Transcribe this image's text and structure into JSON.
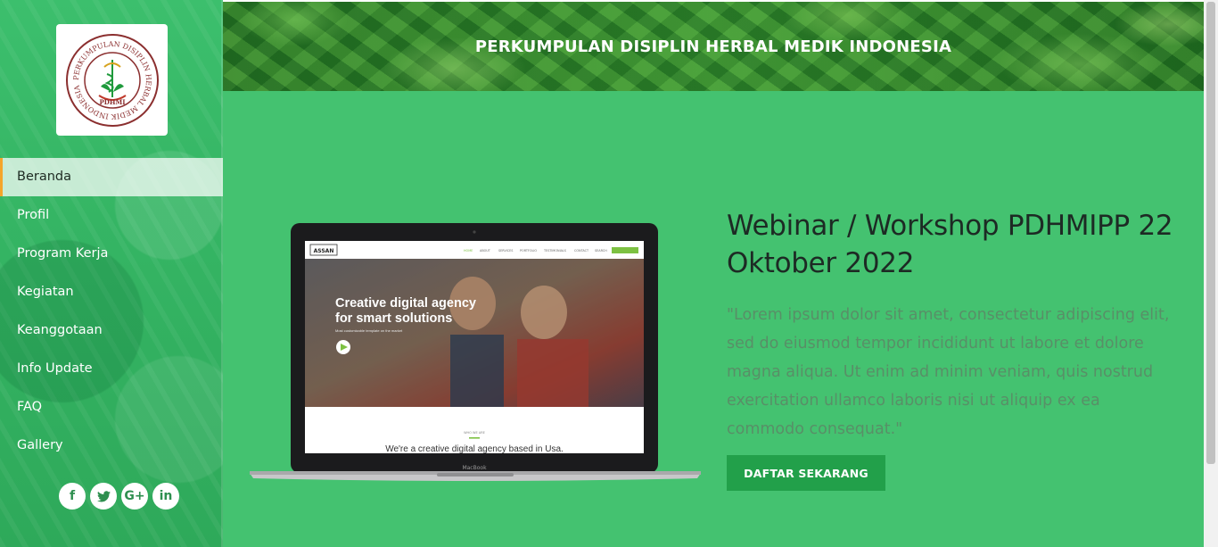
{
  "sidebar": {
    "logo": {
      "ring_text": "PERKUMPULAN DISIPLIN HERBAL MEDIK INDONESIA",
      "abbr": "PDHMI"
    },
    "menu": [
      {
        "label": "Beranda",
        "active": true
      },
      {
        "label": "Profil"
      },
      {
        "label": "Program Kerja"
      },
      {
        "label": "Kegiatan"
      },
      {
        "label": "Keanggotaan"
      },
      {
        "label": "Info Update"
      },
      {
        "label": "FAQ"
      },
      {
        "label": "Gallery"
      }
    ],
    "social": [
      {
        "icon": "facebook-icon",
        "glyph": "f"
      },
      {
        "icon": "twitter-icon",
        "glyph": "🐦"
      },
      {
        "icon": "google-plus-icon",
        "glyph": "G+"
      },
      {
        "icon": "linkedin-icon",
        "glyph": "in"
      }
    ]
  },
  "header": {
    "title": "PERKUMPULAN DISIPLIN HERBAL MEDIK INDONESIA"
  },
  "hero": {
    "laptop_screen": {
      "brand": "ASSAN",
      "nav": [
        "HOME",
        "ABOUT",
        "SERVICES",
        "PORTFOLIO",
        "TESTIMONIALS",
        "CONTACT",
        "SEARCH"
      ],
      "headline_line1": "Creative digital agency",
      "headline_line2": "for smart solutions",
      "subline": "Most customizable template on the market",
      "about_label": "WHO WE ARE",
      "about_text": "We're a creative digital agency based in Usa.",
      "device_label": "MacBook"
    },
    "title": "Webinar / Workshop PDHMIPP 22 Oktober 2022",
    "description": "\"Lorem ipsum dolor sit amet, consectetur adipiscing elit, sed do eiusmod tempor incididunt ut labore et dolore magna aliqua. Ut enim ad minim veniam, quis nostrud exercitation ullamco laboris nisi ut aliquip ex ea commodo consequat.\"",
    "cta_label": "DAFTAR SEKARANG"
  },
  "colors": {
    "sidebar_green": "#35b564",
    "hero_green": "#44c270",
    "cta_green": "#22a04a",
    "active_accent": "#f4a52a"
  }
}
